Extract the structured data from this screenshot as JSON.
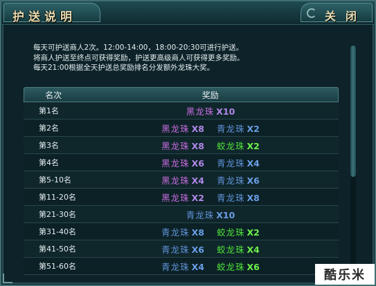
{
  "window": {
    "title": "护送说明",
    "close_label": "关闭"
  },
  "description": {
    "lines": [
      "每天可护送商人2次。12:00-14:00，18:00-20:30可进行护送。",
      "将商人护送至终点可获得奖励，护送更高级商人可获得更多奖励。",
      "每天21:00根据全天护送总奖励排名分发额外龙珠大奖。"
    ]
  },
  "table": {
    "headers": {
      "rank": "名次",
      "reward": "奖励"
    },
    "rows": [
      {
        "rank": "第1名",
        "rewards": [
          {
            "name": "黑龙珠",
            "qty": "X10",
            "color": "purple"
          }
        ]
      },
      {
        "rank": "第2名",
        "rewards": [
          {
            "name": "黑龙珠",
            "qty": "X8",
            "color": "purple"
          },
          {
            "name": "青龙珠",
            "qty": "X2",
            "color": "blue"
          }
        ]
      },
      {
        "rank": "第3名",
        "rewards": [
          {
            "name": "黑龙珠",
            "qty": "X8",
            "color": "purple"
          },
          {
            "name": "蛟龙珠",
            "qty": "X2",
            "color": "green"
          }
        ]
      },
      {
        "rank": "第4名",
        "rewards": [
          {
            "name": "黑龙珠",
            "qty": "X6",
            "color": "purple"
          },
          {
            "name": "青龙珠",
            "qty": "X4",
            "color": "blue"
          }
        ]
      },
      {
        "rank": "第5-10名",
        "rewards": [
          {
            "name": "黑龙珠",
            "qty": "X4",
            "color": "purple"
          },
          {
            "name": "青龙珠",
            "qty": "X6",
            "color": "blue"
          }
        ]
      },
      {
        "rank": "第11-20名",
        "rewards": [
          {
            "name": "黑龙珠",
            "qty": "X2",
            "color": "purple"
          },
          {
            "name": "青龙珠",
            "qty": "X8",
            "color": "blue"
          }
        ]
      },
      {
        "rank": "第21-30名",
        "rewards": [
          {
            "name": "青龙珠",
            "qty": "X10",
            "color": "blue"
          }
        ]
      },
      {
        "rank": "第31-40名",
        "rewards": [
          {
            "name": "青龙珠",
            "qty": "X8",
            "color": "blue"
          },
          {
            "name": "蛟龙珠",
            "qty": "X2",
            "color": "green"
          }
        ]
      },
      {
        "rank": "第41-50名",
        "rewards": [
          {
            "name": "青龙珠",
            "qty": "X6",
            "color": "blue"
          },
          {
            "name": "蛟龙珠",
            "qty": "X4",
            "color": "green"
          }
        ]
      },
      {
        "rank": "第51-60名",
        "rewards": [
          {
            "name": "青龙珠",
            "qty": "X4",
            "color": "blue"
          },
          {
            "name": "蛟龙珠",
            "qty": "X6",
            "color": "green"
          }
        ]
      }
    ]
  },
  "watermark": {
    "text": "酷乐米"
  },
  "colors": {
    "purple": "#c86de0",
    "blue": "#5f93d8",
    "green": "#4fe23a",
    "title_text": "#e9dcb0",
    "panel_bg": "#0d2329"
  }
}
